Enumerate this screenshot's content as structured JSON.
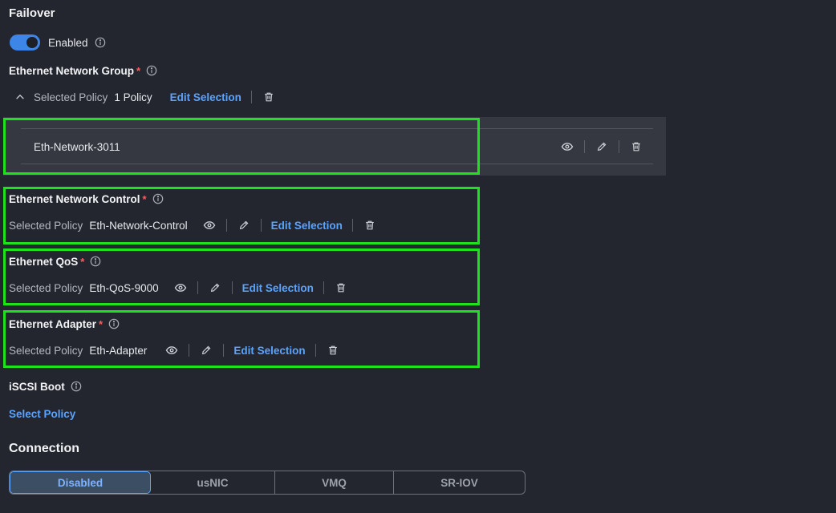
{
  "failover": {
    "title": "Failover",
    "toggle_label": "Enabled"
  },
  "ethernet_network_group": {
    "label": "Ethernet Network Group",
    "required_mark": "*",
    "selected_policy_label": "Selected Policy",
    "policy_count": "1 Policy",
    "edit_selection": "Edit Selection",
    "items": [
      {
        "name": "Eth-Network-3011"
      }
    ]
  },
  "ethernet_network_control": {
    "label": "Ethernet Network Control",
    "required_mark": "*",
    "selected_policy_label": "Selected Policy",
    "value": "Eth-Network-Control",
    "edit_selection": "Edit Selection"
  },
  "ethernet_qos": {
    "label": "Ethernet QoS",
    "required_mark": "*",
    "selected_policy_label": "Selected Policy",
    "value": "Eth-QoS-9000",
    "edit_selection": "Edit Selection"
  },
  "ethernet_adapter": {
    "label": "Ethernet Adapter",
    "required_mark": "*",
    "selected_policy_label": "Selected Policy",
    "value": "Eth-Adapter",
    "edit_selection": "Edit Selection"
  },
  "iscsi_boot": {
    "label": "iSCSI Boot",
    "select_policy": "Select Policy"
  },
  "connection": {
    "title": "Connection",
    "options": [
      "Disabled",
      "usNIC",
      "VMQ",
      "SR-IOV"
    ],
    "selected": "Disabled"
  },
  "colors": {
    "background": "#23262f",
    "accent": "#5aa3ff",
    "highlight": "#1ee21b",
    "required": "#ff5c5c"
  },
  "icons": {
    "info": "info-icon",
    "view": "eye-icon",
    "edit": "pencil-icon",
    "delete": "trash-icon",
    "collapse": "chevron-up-icon"
  }
}
